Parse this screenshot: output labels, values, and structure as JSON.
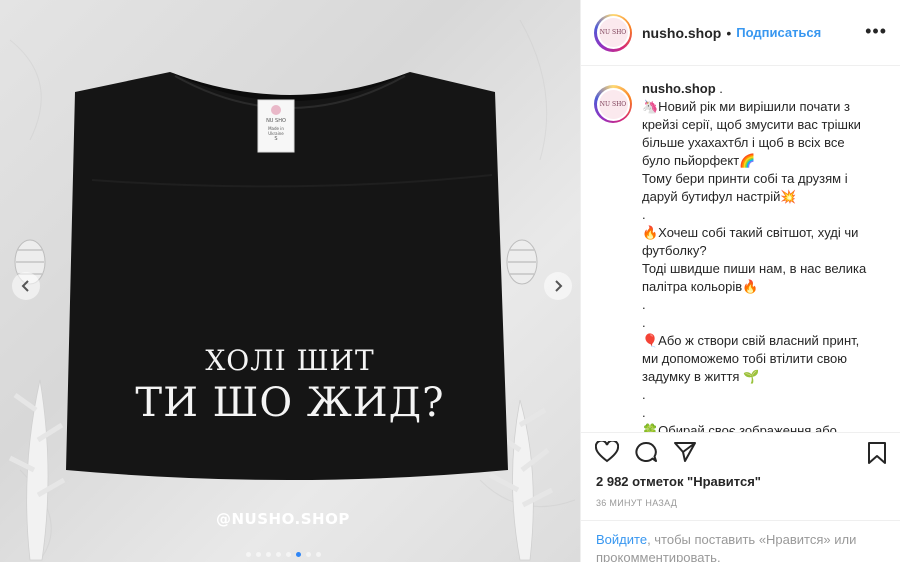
{
  "photo": {
    "label_brand": "NU SHO",
    "label_sub": "Made in Ukraine",
    "label_size": "S",
    "shirt_line1": "ХОЛІ ШИТ",
    "shirt_line2": "ТИ ШО ЖИД?",
    "watermark": "@NUSHO.SHOP",
    "prev_icon": "chevron-left-icon",
    "next_icon": "chevron-right-icon",
    "dots_count": 8,
    "active_dot": 5
  },
  "header": {
    "avatar_text": "NU SHO",
    "username": "nusho.shop",
    "separator": "•",
    "follow_label": "Подписаться",
    "more_label": "•••"
  },
  "caption": {
    "username": "nusho.shop",
    "suffix": " .",
    "lines": [
      "🦄Новий рік ми вирішили почати з",
      "крейзі серії, щоб змусити вас трішки",
      "більше ухахахтбл і щоб в всіх все",
      "було пьйорфект🌈",
      "Тому бери принти собі та друзям і",
      "даруй бутифул настрій💥",
      ".",
      "🔥Хочеш собі такий світшот, худі чи",
      "футболку?",
      "Тоді швидше пиши нам, в нас велика",
      "палітра кольорів🔥",
      ".",
      ".",
      "🎈Або ж створи свій власний принт,",
      "ми допоможемо тобі втілити свою",
      "задумку в життя 🌱",
      ".",
      ".",
      "🍀Обирай своє зображення або"
    ]
  },
  "actions": {
    "like_icon": "heart-icon",
    "comment_icon": "comment-icon",
    "share_icon": "share-icon",
    "save_icon": "bookmark-icon"
  },
  "likes_text": "2 982 отметок \"Нравится\"",
  "time_text": "36 МИНУТ НАЗАД",
  "login": {
    "link": "Войдите",
    "text": ", чтобы поставить «Нравится» или прокомментировать."
  },
  "colors": {
    "accent": "#3897f0",
    "text": "#262626",
    "muted": "#999999",
    "shirt": "#141414",
    "background": "#dedede"
  }
}
